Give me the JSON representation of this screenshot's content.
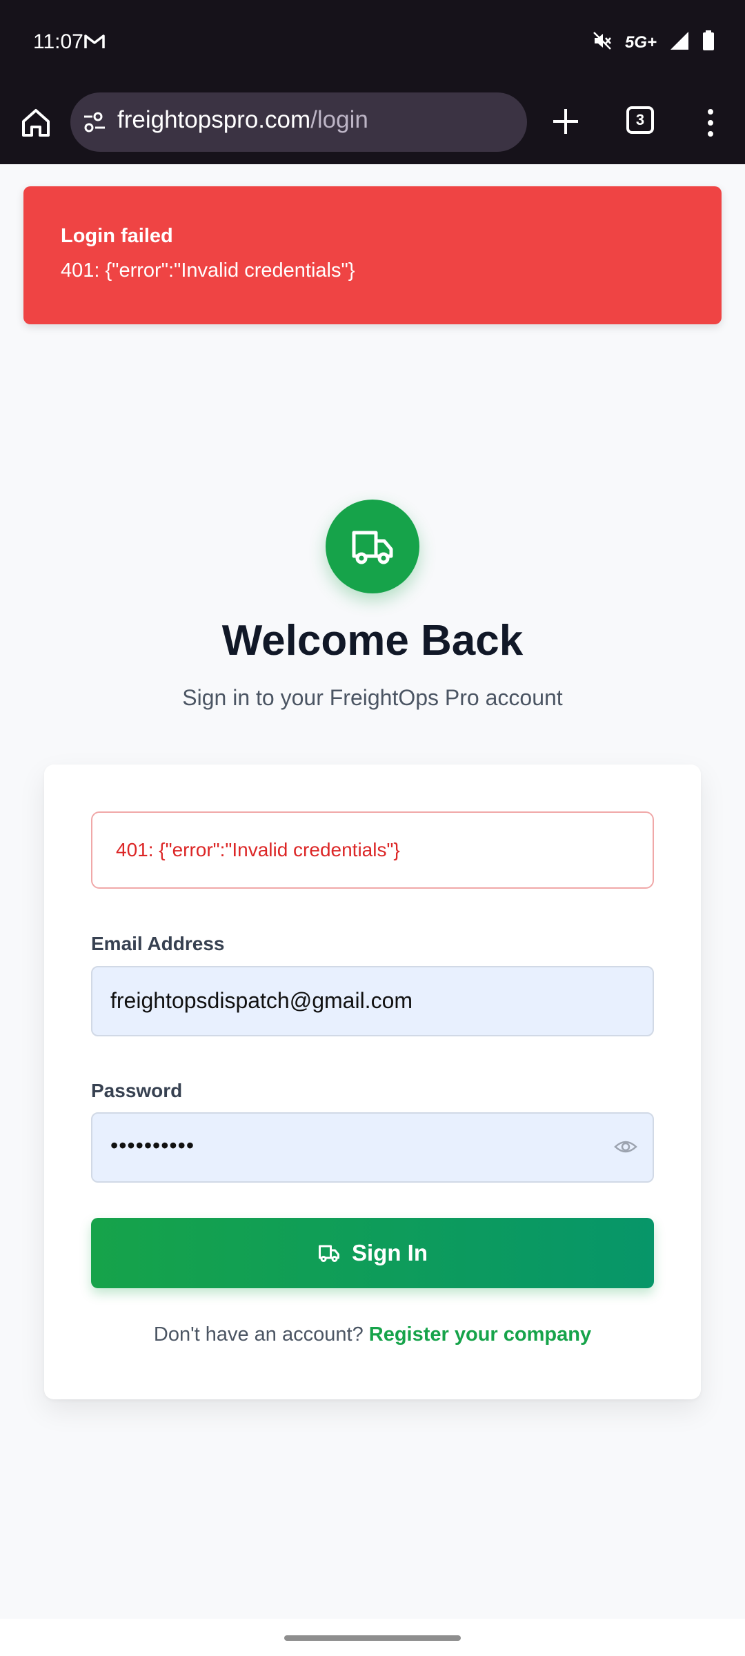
{
  "status_bar": {
    "time": "11:07",
    "network": "5G+",
    "icons": [
      "gmail-icon",
      "mute-icon",
      "signal-icon",
      "battery-icon"
    ]
  },
  "browser": {
    "url_domain": "freightopspro.com",
    "url_path": "/login",
    "tab_count": "3",
    "icons": [
      "home-icon",
      "site-settings-icon",
      "plus-icon",
      "tabs-icon",
      "more-vert-icon"
    ]
  },
  "toast": {
    "title": "Login failed",
    "message": "401: {\"error\":\"Invalid credentials\"}",
    "color": "#ef4444"
  },
  "header": {
    "title": "Welcome Back",
    "subtitle": "Sign in to your FreightOps Pro account",
    "logo_icon": "truck-icon",
    "brand_color": "#16a34a"
  },
  "form": {
    "error_text": "401: {\"error\":\"Invalid credentials\"}",
    "email_label": "Email Address",
    "email_value": "freightopsdispatch@gmail.com",
    "password_label": "Password",
    "password_value": "••••••••••",
    "submit_label": "Sign In",
    "register_prompt": "Don't have an account?",
    "register_link": "Register your company"
  }
}
